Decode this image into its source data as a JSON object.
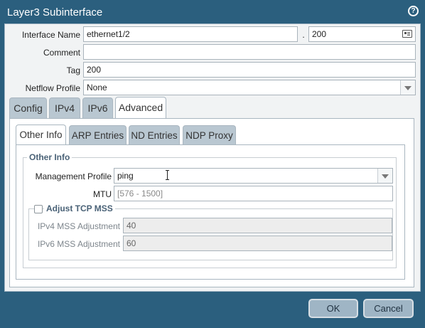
{
  "window": {
    "title": "Layer3 Subinterface",
    "help_icon": "?"
  },
  "form": {
    "interface_name_label": "Interface Name",
    "interface_name_value": "ethernet1/2",
    "separator": ".",
    "subinterface_tag": "200",
    "comment_label": "Comment",
    "comment_value": "",
    "tag_label": "Tag",
    "tag_value": "200",
    "netflow_label": "Netflow Profile",
    "netflow_value": "None"
  },
  "tabs": [
    {
      "label": "Config",
      "active": false
    },
    {
      "label": "IPv4",
      "active": false
    },
    {
      "label": "IPv6",
      "active": false
    },
    {
      "label": "Advanced",
      "active": true
    }
  ],
  "subtabs": [
    {
      "label": "Other Info",
      "active": true
    },
    {
      "label": "ARP Entries",
      "active": false
    },
    {
      "label": "ND Entries",
      "active": false
    },
    {
      "label": "NDP Proxy",
      "active": false
    }
  ],
  "other_info": {
    "legend": "Other Info",
    "mgmt_profile_label": "Management Profile",
    "mgmt_profile_value": "ping",
    "mtu_label": "MTU",
    "mtu_placeholder": "[576 - 1500]",
    "adjust_tcp_mss_label": "Adjust TCP MSS",
    "adjust_tcp_mss_checked": false,
    "ipv4_mss_label": "IPv4 MSS Adjustment",
    "ipv4_mss_value": "40",
    "ipv6_mss_label": "IPv6 MSS Adjustment",
    "ipv6_mss_value": "60"
  },
  "buttons": {
    "ok": "OK",
    "cancel": "Cancel"
  }
}
